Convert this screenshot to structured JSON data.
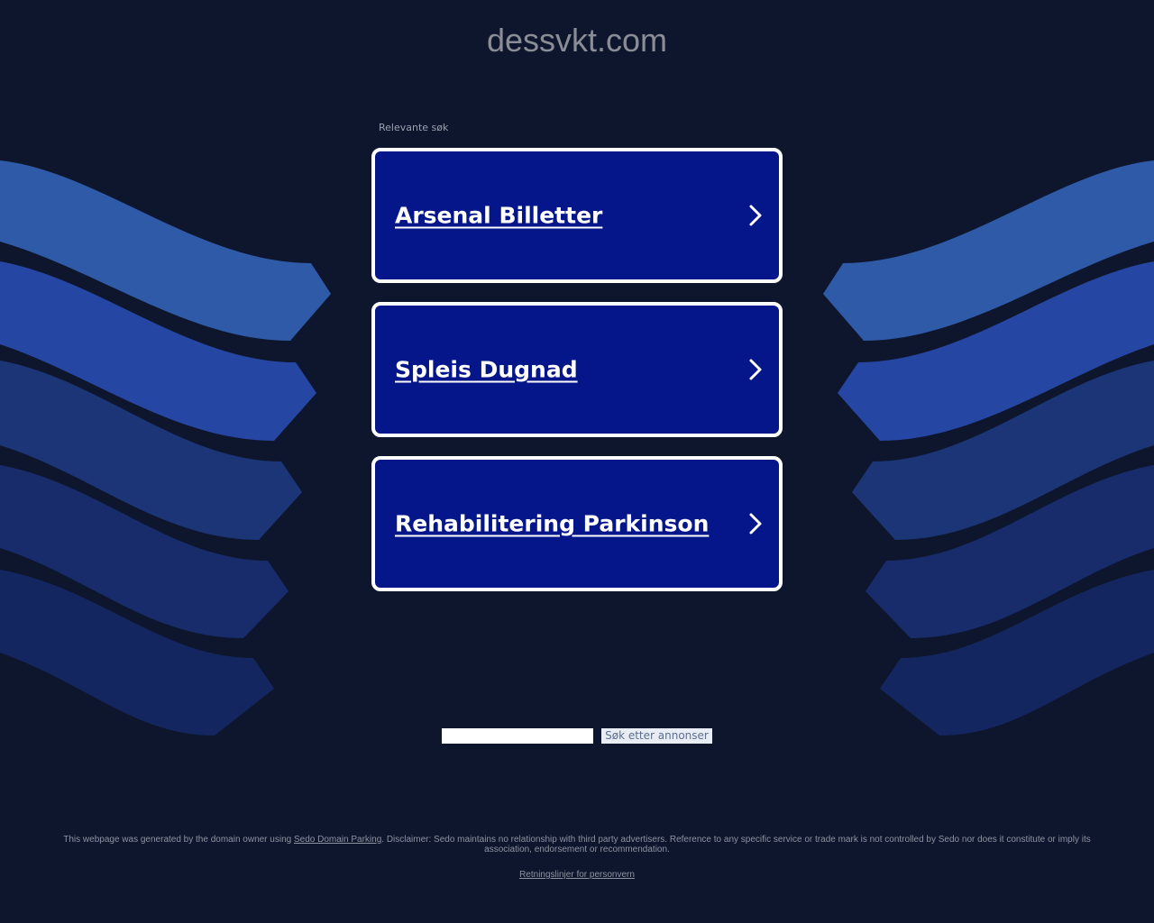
{
  "header": {
    "domain": "dessvkt.com"
  },
  "related": {
    "label": "Relevante søk",
    "links": [
      {
        "label": "Arsenal Billetter"
      },
      {
        "label": "Spleis Dugnad"
      },
      {
        "label": "Rehabilitering Parkinson"
      }
    ]
  },
  "search": {
    "input_value": "",
    "button_label": "Søk etter annonser"
  },
  "footer": {
    "disclaimer_prefix": "This webpage was generated by the domain owner using ",
    "disclaimer_link": "Sedo Domain Parking",
    "disclaimer_suffix": ". Disclaimer: Sedo maintains no relationship with third party advertisers. Reference to any specific service or trade mark is not controlled by Sedo nor does it constitute or imply its association, endorsement or recommendation.",
    "privacy_link": "Retningslinjer for personvern"
  },
  "colors": {
    "background": "#0e162e",
    "card": "#05168a",
    "wave_1": "#2f5aa8",
    "wave_2": "#2646a3",
    "wave_3": "#1b3577",
    "wave_4": "#182c6b",
    "wave_5": "#14265f",
    "wave_6": "#12225a"
  }
}
